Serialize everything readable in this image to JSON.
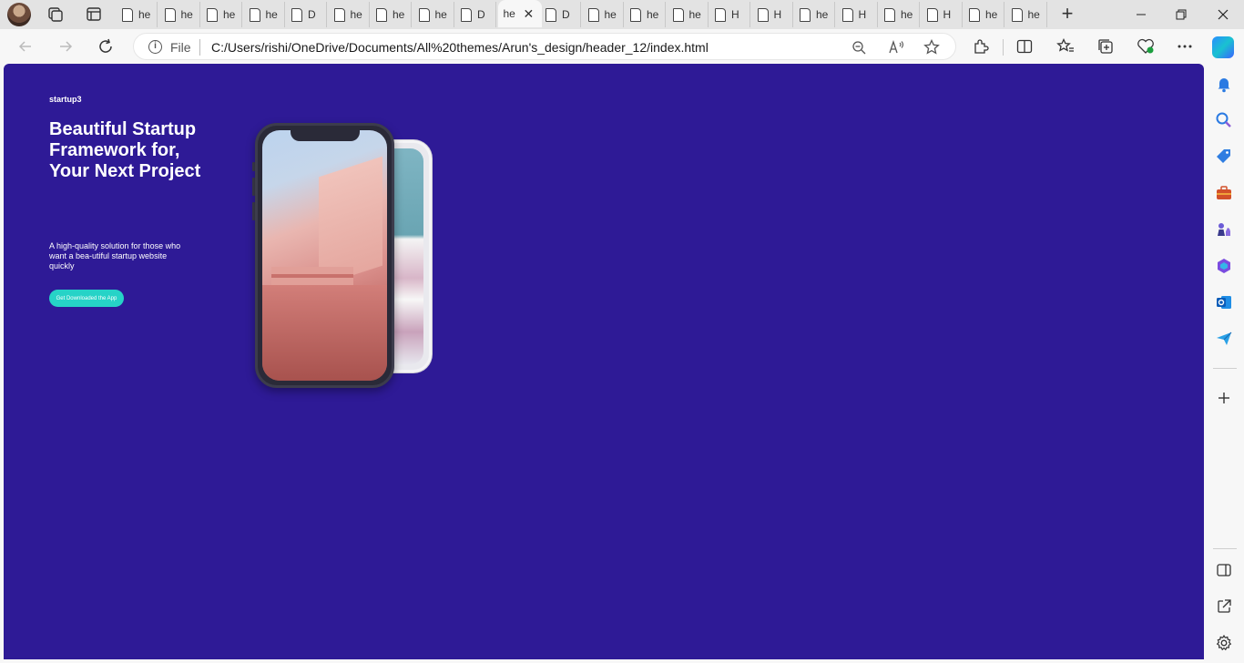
{
  "browser": {
    "tabs": [
      {
        "title": "he"
      },
      {
        "title": "he"
      },
      {
        "title": "he"
      },
      {
        "title": "he"
      },
      {
        "title": "D"
      },
      {
        "title": "he"
      },
      {
        "title": "he"
      },
      {
        "title": "he"
      },
      {
        "title": "D"
      },
      {
        "title": "he",
        "active": true
      },
      {
        "title": "D"
      },
      {
        "title": "he"
      },
      {
        "title": "he"
      },
      {
        "title": "he"
      },
      {
        "title": "H"
      },
      {
        "title": "H"
      },
      {
        "title": "he"
      },
      {
        "title": "H"
      },
      {
        "title": "he"
      },
      {
        "title": "H"
      },
      {
        "title": "he"
      },
      {
        "title": "he"
      }
    ],
    "new_tab_label": "+",
    "address": {
      "scheme_label": "File",
      "url": "C:/Users/rishi/OneDrive/Documents/All%20themes/Arun's_design/header_12/index.html"
    }
  },
  "page": {
    "brand": "startup3",
    "headline": "Beautiful Startup Framework for, Your Next Project",
    "subtext": "A high-quality solution for those who want a bea-utiful startup website quickly",
    "cta_label": "Get Downloaded the App",
    "background_color": "#2e1a96",
    "accent_color": "#26d3c7"
  }
}
